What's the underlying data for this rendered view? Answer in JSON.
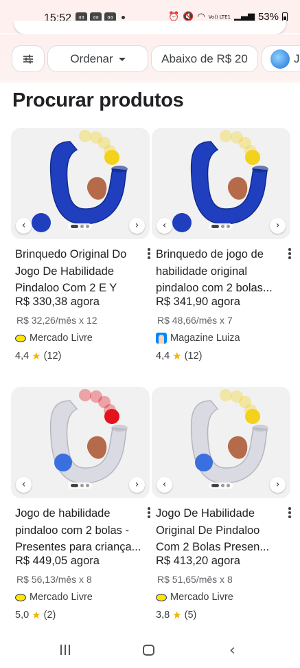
{
  "status_bar": {
    "time": "15:52",
    "battery": "53%",
    "network": "Vo)) LTE1",
    "app_badges": [
      "aa",
      "aa",
      "aa"
    ]
  },
  "filters": {
    "sort_label": "Ordenar",
    "price_label": "Abaixo de R$ 20",
    "brand_label": "J"
  },
  "section_title": "Procurar produtos",
  "products": [
    {
      "title": "Brinquedo Original Do Jogo De Habilidade Pindaloo Com 2 E Y",
      "price": "R$ 330,38 agora",
      "installment": "R$ 32,26/mês x 12",
      "store": "Mercado Livre",
      "rating": "4,4",
      "reviews": "(12)",
      "image_variant": "blue"
    },
    {
      "title": "Brinquedo de jogo de habilidade original pindaloo com 2 bolas...",
      "price": "R$ 341,90 agora",
      "installment": "R$ 48,66/mês x 7",
      "store": "Magazine Luiza",
      "rating": "4,4",
      "reviews": "(12)",
      "image_variant": "blue"
    },
    {
      "title": "Jogo de habilidade pindaloo com 2 bolas - Presentes para criança...",
      "price": "R$ 449,05 agora",
      "installment": "R$ 56,13/mês x 8",
      "store": "Mercado Livre",
      "rating": "5,0",
      "reviews": "(2)",
      "image_variant": "clear-red"
    },
    {
      "title": "Jogo De Habilidade Original De Pindaloo Com 2 Bolas Presen...",
      "price": "R$ 413,20 agora",
      "installment": "R$ 51,65/mês x 8",
      "store": "Mercado Livre",
      "rating": "3,8",
      "reviews": "(5)",
      "image_variant": "clear-yellow"
    }
  ],
  "colors": {
    "header_bg": "#fdf0ee",
    "star": "#f4b400",
    "toy_blue": "#1f3fbf",
    "ball_yellow": "#f2d21a",
    "ball_red": "#e3121b"
  }
}
